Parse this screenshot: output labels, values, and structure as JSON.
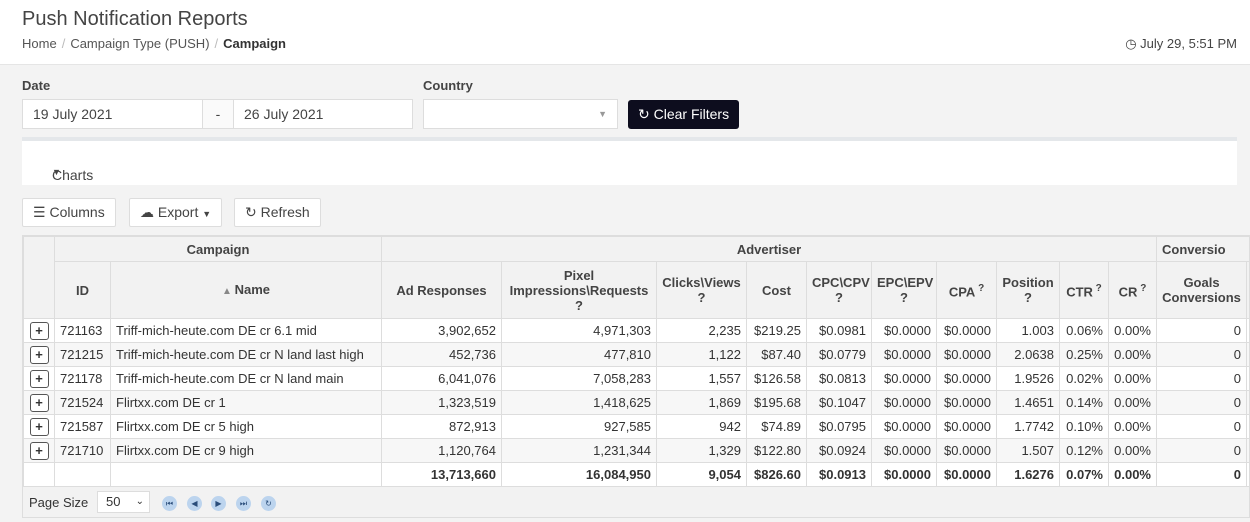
{
  "header": {
    "title": "Push Notification Reports",
    "breadcrumb": [
      "Home",
      "Campaign Type (PUSH)",
      "Campaign"
    ],
    "time": "July 29, 5:51 PM"
  },
  "filters": {
    "date_label": "Date",
    "date_from": "19 July 2021",
    "date_sep": "-",
    "date_to": "26 July 2021",
    "country_label": "Country",
    "country_value": "",
    "clear": "Clear Filters"
  },
  "charts_label": "Charts",
  "toolbar": {
    "columns": "Columns",
    "export": "Export",
    "refresh": "Refresh"
  },
  "table": {
    "groups": [
      "Campaign",
      "Advertiser",
      "Conversio"
    ],
    "columns": [
      "ID",
      "Name",
      "Ad Responses",
      "Pixel Impressions\\Requests",
      "Clicks\\Views",
      "Cost",
      "CPC\\CPV",
      "EPC\\EPV",
      "CPA",
      "Position",
      "CTR",
      "CR",
      "Goals Conversions"
    ],
    "rows": [
      [
        "721163",
        "Triff-mich-heute.com DE cr 6.1 mid",
        "3,902,652",
        "4,971,303",
        "2,235",
        "$219.25",
        "$0.0981",
        "$0.0000",
        "$0.0000",
        "1.003",
        "0.06%",
        "0.00%",
        "0"
      ],
      [
        "721215",
        "Triff-mich-heute.com DE cr N land last high",
        "452,736",
        "477,810",
        "1,122",
        "$87.40",
        "$0.0779",
        "$0.0000",
        "$0.0000",
        "2.0638",
        "0.25%",
        "0.00%",
        "0"
      ],
      [
        "721178",
        "Triff-mich-heute.com DE cr N land main",
        "6,041,076",
        "7,058,283",
        "1,557",
        "$126.58",
        "$0.0813",
        "$0.0000",
        "$0.0000",
        "1.9526",
        "0.02%",
        "0.00%",
        "0"
      ],
      [
        "721524",
        "Flirtxx.com DE cr 1",
        "1,323,519",
        "1,418,625",
        "1,869",
        "$195.68",
        "$0.1047",
        "$0.0000",
        "$0.0000",
        "1.4651",
        "0.14%",
        "0.00%",
        "0"
      ],
      [
        "721587",
        "Flirtxx.com DE cr 5 high",
        "872,913",
        "927,585",
        "942",
        "$74.89",
        "$0.0795",
        "$0.0000",
        "$0.0000",
        "1.7742",
        "0.10%",
        "0.00%",
        "0"
      ],
      [
        "721710",
        "Flirtxx.com DE cr 9 high",
        "1,120,764",
        "1,231,344",
        "1,329",
        "$122.80",
        "$0.0924",
        "$0.0000",
        "$0.0000",
        "1.507",
        "0.12%",
        "0.00%",
        "0"
      ]
    ],
    "totals": [
      "",
      "",
      "13,713,660",
      "16,084,950",
      "9,054",
      "$826.60",
      "$0.0913",
      "$0.0000",
      "$0.0000",
      "1.6276",
      "0.07%",
      "0.00%",
      "0"
    ]
  },
  "footer": {
    "page_size_label": "Page Size",
    "page_size": "50"
  }
}
